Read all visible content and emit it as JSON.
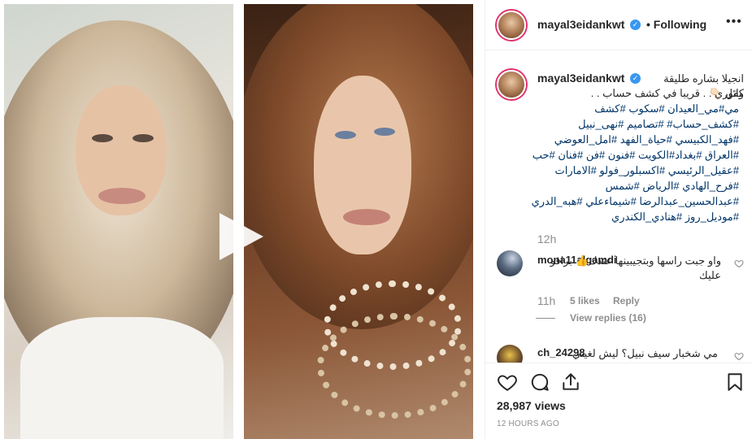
{
  "post": {
    "username": "mayal3eidankwt",
    "follow_status": "Following",
    "more": "•••"
  },
  "caption": {
    "username": "mayal3eidankwt",
    "line1": "انجيلا بشاره طليقة وائل 👇🏻",
    "line2": "كفوري . . قريبا في كشف حساب . .",
    "hashtags": "مي#مي_العيدان #سكوب #كشف #كشف_حساب# #تصاميم #نهى_نبيل #فهد_الكبيسي #حياة_الفهد #امل_العوضي #العراق #بغداد#الكويت #فنون #فن #فنان #حب #عقيل_الرئيسي #اكسبلور_فولو #الامارات #فرح_الهادي #الرياض #شمس #عبدالحسين_عبدالرضا #شيماءعلي #هبه_الدري #موديل_روز #هنادي_الكندري",
    "time": "12h"
  },
  "comments": [
    {
      "username": "mona11algamdi",
      "text": "واو جبت راسها وبتجيبينها عندك👍 برافو عليك",
      "time": "11h",
      "likes": "5 likes",
      "reply": "Reply",
      "view_replies": "View replies (16)"
    },
    {
      "username": "ch_24298",
      "text": "مي شخبار سيف نبيل؟ ليش لغيتي"
    }
  ],
  "stats": {
    "views": "28,987 views",
    "posted": "12 HOURS AGO"
  },
  "icons": {
    "verified": "verified-badge-icon",
    "play": "play-icon",
    "like": "heart-icon",
    "comment": "comment-icon",
    "share": "share-icon",
    "save": "bookmark-icon",
    "more": "more-icon"
  },
  "colors": {
    "verified_blue": "#3897f0",
    "hashtag": "#003569",
    "muted": "#8e8e8e",
    "text": "#262626"
  }
}
